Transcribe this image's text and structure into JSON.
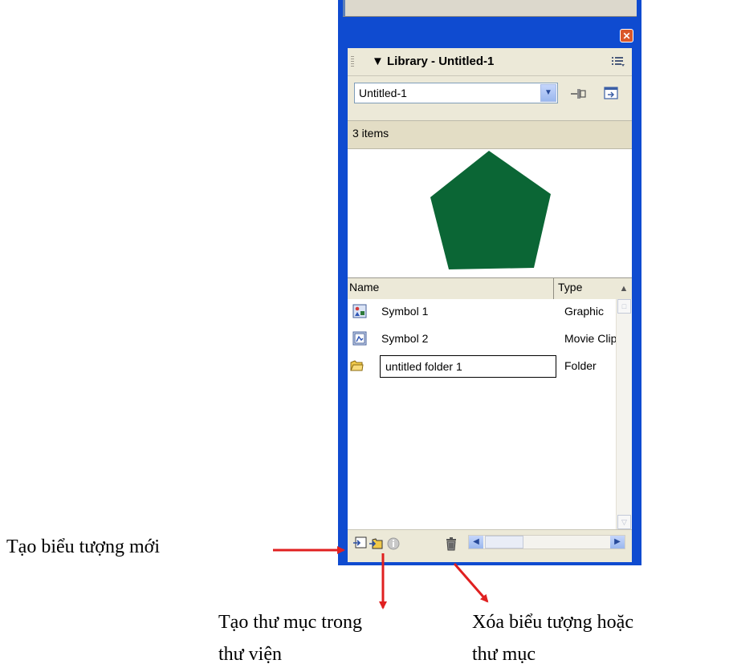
{
  "panel": {
    "title": "▼ Library - Untitled-1",
    "document_select": {
      "value": "Untitled-1"
    },
    "item_count": "3 items",
    "preview": {
      "shape": "pentagon",
      "fill": "#0b6635"
    },
    "columns": {
      "name": "Name",
      "type": "Type"
    },
    "items": [
      {
        "name": "Symbol 1",
        "type": "Graphic",
        "icon": "graphic-symbol-icon"
      },
      {
        "name": "Symbol 2",
        "type": "Movie Clip",
        "icon": "movieclip-symbol-icon"
      },
      {
        "name": "untitled folder 1",
        "type": "Folder",
        "icon": "folder-icon",
        "editing": true
      }
    ],
    "toolbar": [
      "new-symbol-icon",
      "new-folder-icon",
      "properties-icon",
      "delete-icon"
    ]
  },
  "annotations": {
    "new_symbol": "Tạo biểu tượng mới",
    "new_folder_line1": "Tạo thư mục trong",
    "new_folder_line2": "thư viện",
    "delete_line1": "Xóa biểu tượng hoặc",
    "delete_line2": "thư mục"
  },
  "colors": {
    "window_frame": "#0f4bd0",
    "panel_bg": "#ece9d8",
    "arrow": "#e02020",
    "pentagon": "#0b6635"
  }
}
